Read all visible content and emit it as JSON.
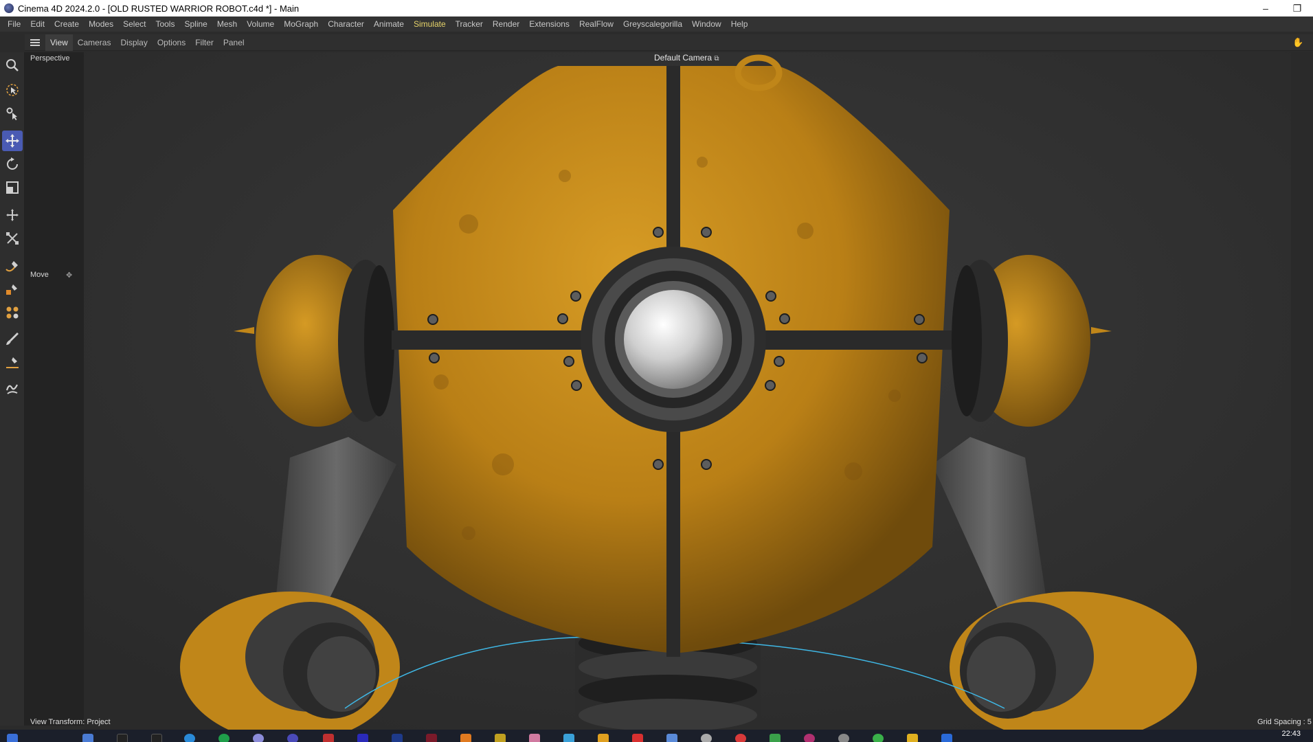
{
  "window": {
    "title": "Cinema 4D 2024.2.0 - [OLD RUSTED WARRIOR ROBOT.c4d *] - Main",
    "minimize_glyph": "–",
    "restore_glyph": "❐"
  },
  "menubar": {
    "items": [
      "File",
      "Edit",
      "Create",
      "Modes",
      "Select",
      "Tools",
      "Spline",
      "Mesh",
      "Volume",
      "MoGraph",
      "Character",
      "Animate",
      "Simulate",
      "Tracker",
      "Render",
      "Extensions",
      "RealFlow",
      "Greyscalegorilla",
      "Window",
      "Help"
    ],
    "active": "Simulate"
  },
  "viewport_menu": {
    "items": [
      "View",
      "Cameras",
      "Display",
      "Options",
      "Filter",
      "Panel"
    ],
    "selected": "View"
  },
  "viewport": {
    "projection": "Perspective",
    "camera": "Default Camera",
    "active_tool": "Move",
    "view_transform": "View Transform: Project",
    "grid_spacing": "Grid Spacing : 5"
  },
  "toolbar": {
    "tools": [
      "search-icon",
      "live-select-icon",
      "tweak-icon",
      "move-icon",
      "rotate-icon",
      "scale-icon",
      "transfer-icon",
      "snap-icon",
      "spline-pen-icon",
      "box-icon",
      "atoms-icon",
      "brush-icon",
      "knife-icon",
      "sketch-icon"
    ],
    "selected_tool": "move-icon"
  },
  "taskbar": {
    "time": "22:43"
  },
  "colors": {
    "accent": "#4a5bb3",
    "active_menu": "#e6d36a",
    "robot_paint": "#c98f1a",
    "spline": "#3fb8e6"
  }
}
